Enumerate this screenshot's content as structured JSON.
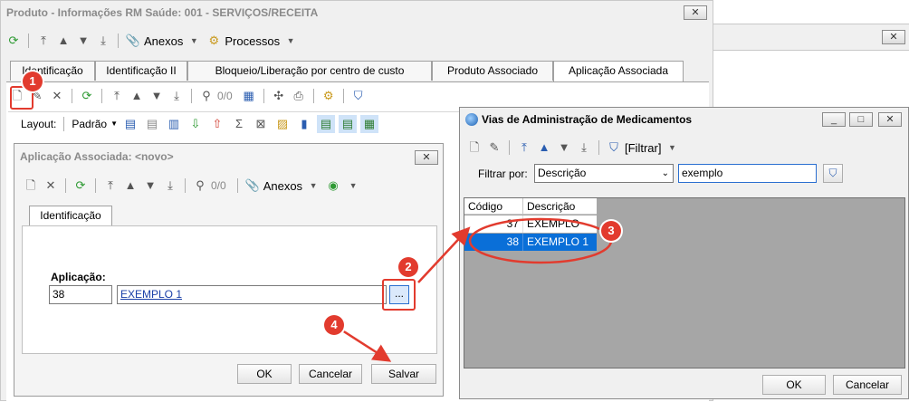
{
  "main_window": {
    "title": "Produto - Informações RM Saúde: 001 - SERVIÇOS/RECEITA",
    "close_label": "✕",
    "toolbar": {
      "anexos": "Anexos",
      "processos": "Processos"
    },
    "tabs": [
      "Identificação",
      "Identificação II",
      "Bloqueio/Liberação por centro de custo",
      "Produto Associado",
      "Aplicação Associada"
    ],
    "sub_toolbar": {
      "counter": "0/0"
    },
    "layout_bar": {
      "layout_label": "Layout:",
      "padrao_label": "Padrão"
    }
  },
  "bg_window_close": "✕",
  "dialog": {
    "title": "Aplicação Associada: <novo>",
    "close_label": "✕",
    "toolbar": {
      "counter": "0/0",
      "anexos": "Anexos"
    },
    "tab": "Identificação",
    "aplicacao_label": "Aplicação:",
    "code_value": "38",
    "desc_value": "EXEMPLO 1",
    "lookup_label": "...",
    "ok": "OK",
    "cancel": "Cancelar",
    "save": "Salvar"
  },
  "lookup_window": {
    "title": "Vias de Administração de Medicamentos",
    "filter_button": "[Filtrar]",
    "filter_by_label": "Filtrar por:",
    "filter_field": "Descrição",
    "filter_value": "exemplo",
    "columns": [
      "Código",
      "Descrição"
    ],
    "rows": [
      {
        "code": "37",
        "desc": "EXEMPLO"
      },
      {
        "code": "38",
        "desc": "EXEMPLO 1"
      }
    ],
    "ok": "OK",
    "cancel": "Cancelar"
  },
  "annotations": [
    "1",
    "2",
    "3",
    "4"
  ],
  "colors": {
    "selection": "#0a6fd8",
    "annotation": "#e23b2e",
    "grid_bg": "#a6a6a6"
  }
}
